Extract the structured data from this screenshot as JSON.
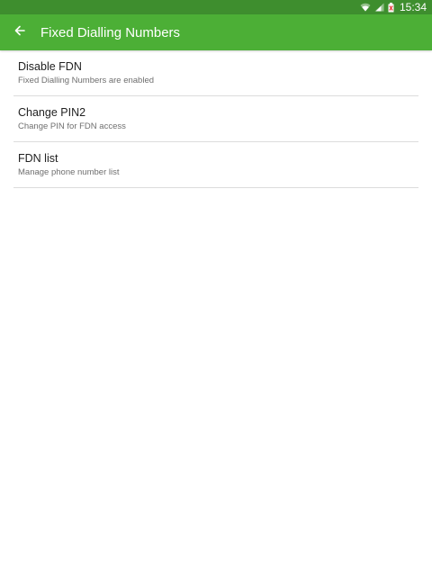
{
  "status_bar": {
    "time": "15:34",
    "icons": [
      "wifi-icon",
      "signal-icon",
      "battery-icon"
    ]
  },
  "app_bar": {
    "back_icon": "arrow-left-icon",
    "title": "Fixed Dialling Numbers"
  },
  "settings": {
    "items": [
      {
        "title": "Disable FDN",
        "subtitle": "Fixed Dialling Numbers are enabled"
      },
      {
        "title": "Change PIN2",
        "subtitle": "Change PIN for FDN access"
      },
      {
        "title": "FDN list",
        "subtitle": "Manage phone number list"
      }
    ]
  },
  "colors": {
    "status_bar": "#3e8e2e",
    "app_bar": "#4caf36",
    "battery_low": "#e53935",
    "divider": "#dcdcdc"
  }
}
